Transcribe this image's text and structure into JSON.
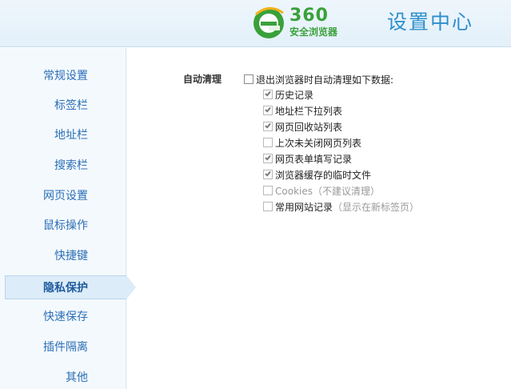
{
  "header": {
    "logo_number": "360",
    "logo_text": "安全浏览器",
    "title": "设置中心",
    "brand_color": "#3aa13a",
    "title_color": "#2d8fcc"
  },
  "sidebar": {
    "items": [
      {
        "label": "常规设置"
      },
      {
        "label": "标签栏"
      },
      {
        "label": "地址栏"
      },
      {
        "label": "搜索栏"
      },
      {
        "label": "网页设置"
      },
      {
        "label": "鼠标操作"
      },
      {
        "label": "快捷键"
      },
      {
        "label": "隐私保护",
        "active": true
      },
      {
        "label": "快速保存"
      },
      {
        "label": "插件隔离"
      },
      {
        "label": "其他"
      }
    ]
  },
  "main": {
    "section_label": "自动清理",
    "master_option": {
      "label": "退出浏览器时自动清理如下数据:",
      "checked": false
    },
    "options": [
      {
        "label": "历史记录",
        "checked": true,
        "disabled": true
      },
      {
        "label": "地址栏下拉列表",
        "checked": true,
        "disabled": true
      },
      {
        "label": "网页回收站列表",
        "checked": true,
        "disabled": true
      },
      {
        "label": "上次未关闭网页列表",
        "checked": false,
        "disabled": true
      },
      {
        "label": "网页表单填写记录",
        "checked": true,
        "disabled": true
      },
      {
        "label": "浏览器缓存的临时文件",
        "checked": true,
        "disabled": true
      },
      {
        "label": "Cookies",
        "note": "（不建议清理）",
        "checked": false,
        "disabled": true
      },
      {
        "label": "常用网站记录",
        "note": "（显示在新标签页）",
        "checked": false,
        "disabled": true
      }
    ]
  }
}
